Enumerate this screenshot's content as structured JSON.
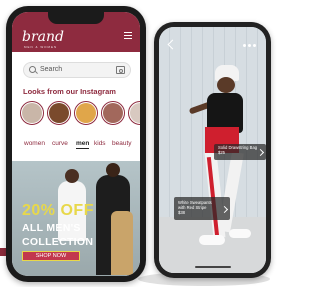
{
  "app": {
    "logo": "brand",
    "tagline": "MEN & WOMEN",
    "search_placeholder": "Search",
    "instagram_title": "Looks from our Instagram",
    "story_colors": [
      "#c9b6a8",
      "#7a4a2c",
      "#e0a64a",
      "#a2685c",
      "#d8c9c0",
      "#b09080"
    ],
    "categories": [
      {
        "label": "women",
        "active": false
      },
      {
        "label": "curve",
        "active": false
      },
      {
        "label": "men",
        "active": true
      },
      {
        "label": "kids",
        "active": false
      },
      {
        "label": "beauty",
        "active": false
      }
    ],
    "banner": {
      "discount": "20% OFF",
      "line1": "ALL MEN'S",
      "line2": "COLLECTION",
      "button": "SHOP NOW"
    },
    "icons": [
      "menu-icon",
      "search-icon",
      "camera-icon"
    ]
  },
  "product_view": {
    "icons": [
      "back-icon",
      "more-icon"
    ],
    "tags": [
      {
        "name_lines": [
          "Solid Drawstring Bag"
        ],
        "price": "$25"
      },
      {
        "name_lines": [
          "White Sweatpants",
          "with Red Stripe"
        ],
        "price": "$38"
      }
    ]
  },
  "colors": {
    "brand": "#8e2b3f",
    "banner_accent": "#e8d84a",
    "banner_button": "#c2374e"
  }
}
